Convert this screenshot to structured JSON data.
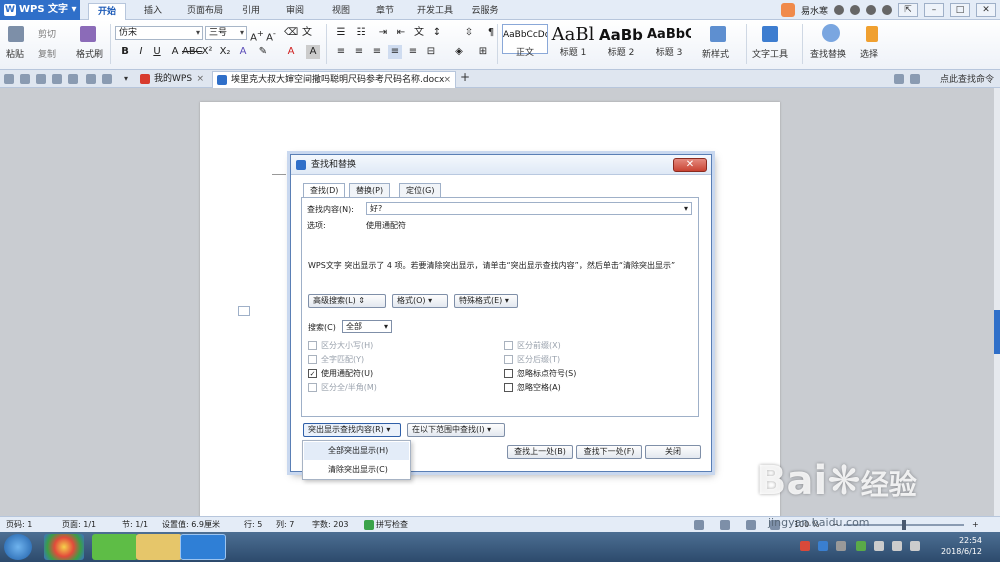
{
  "app": {
    "name": "WPS 文字"
  },
  "menu_tabs": [
    "开始",
    "插入",
    "页面布局",
    "引用",
    "审阅",
    "视图",
    "章节",
    "开发工具",
    "云服务"
  ],
  "user": {
    "name": "易水寒"
  },
  "ribbon": {
    "paste": "粘贴",
    "cut": "剪切",
    "copy": "复制",
    "format_painter": "格式刷",
    "font": "仿宋",
    "size": "三号",
    "styles": [
      {
        "preview": "AaBbCcDd",
        "label": "正文"
      },
      {
        "preview": "AaBl",
        "label": "标题 1"
      },
      {
        "preview": "AaBb(",
        "label": "标题 2"
      },
      {
        "preview": "AaBbC",
        "label": "标题 3"
      }
    ],
    "new_style": "新样式",
    "text_tools": "文字工具",
    "find_replace": "查找替换",
    "select": "选择"
  },
  "tabs": {
    "home": "我的WPS",
    "document": "埃里克大叔大婶空间撒吗聪明尺码参考尺码名称.docx",
    "cmd_search": "点此查找命令"
  },
  "dialog": {
    "title": "查找和替换",
    "tabs": [
      "查找(D)",
      "替换(P)",
      "定位(G)"
    ],
    "find_label": "查找内容(N):",
    "find_value": "好?",
    "options_label": "选项:",
    "options_value": "使用通配符",
    "message": "WPS文字 突出显示了 4 项。若要清除突出显示，请单击“突出显示查找内容”，然后单击“清除突出显示”",
    "advanced_search": "高级搜索(L) ⇕",
    "format": "格式(O) ▾",
    "special_format": "特殊格式(E) ▾",
    "search_label": "搜索(C)",
    "search_value": "全部",
    "checkboxes_left": [
      {
        "label": "区分大小写(H)",
        "checked": false,
        "enabled": false
      },
      {
        "label": "全字匹配(Y)",
        "checked": false,
        "enabled": false
      },
      {
        "label": "使用通配符(U)",
        "checked": true,
        "enabled": true
      },
      {
        "label": "区分全/半角(M)",
        "checked": false,
        "enabled": false
      }
    ],
    "checkboxes_right": [
      {
        "label": "区分前缀(X)",
        "checked": false,
        "enabled": false
      },
      {
        "label": "区分后缀(T)",
        "checked": false,
        "enabled": false
      },
      {
        "label": "忽略标点符号(S)",
        "checked": false,
        "enabled": true
      },
      {
        "label": "忽略空格(A)",
        "checked": false,
        "enabled": true
      }
    ],
    "highlight_btn": "突出显示查找内容(R) ▾",
    "range_btn": "在以下范围中查找(I) ▾",
    "prev_btn": "查找上一处(B)",
    "next_btn": "查找下一处(F)",
    "close_btn": "关闭"
  },
  "dropdown": {
    "items": [
      "全部突出显示(H)",
      "清除突出显示(C)"
    ]
  },
  "status": {
    "page_no": "页码: 1",
    "pages": "页面: 1/1",
    "section": "节: 1/1",
    "setting": "设置值: 6.9厘米",
    "row": "行: 5",
    "col": "列: 7",
    "words": "字数: 203",
    "spell": "拼写检查",
    "zoom": "100 %"
  },
  "taskbar": {
    "time": "22:54",
    "date": "2018/6/12"
  },
  "watermark": {
    "text": "Bai",
    "text2": "经验",
    "url": "jingyan.baidu.com"
  }
}
